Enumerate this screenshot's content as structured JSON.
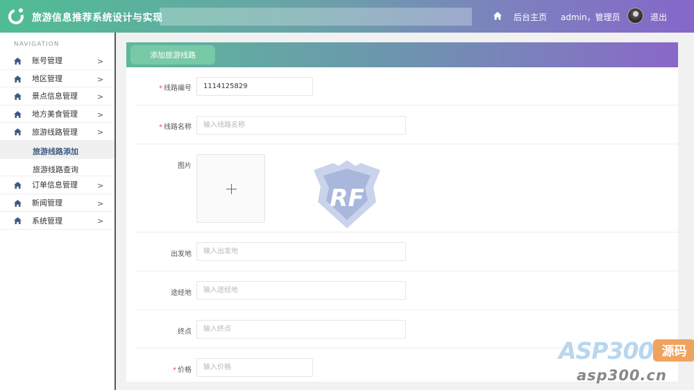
{
  "header": {
    "title": "旅游信息推荐系统设计与实现",
    "home_label": "后台主页",
    "user_text": "admin，管理员",
    "logout_label": "退出"
  },
  "sidebar": {
    "heading": "NAVIGATION",
    "items": [
      {
        "label": "账号管理",
        "icon": "home-icon"
      },
      {
        "label": "地区管理",
        "icon": "home-icon"
      },
      {
        "label": "景点信息管理",
        "icon": "home-icon"
      },
      {
        "label": "地方美食管理",
        "icon": "home-icon"
      },
      {
        "label": "旅游线路管理",
        "icon": "home-icon"
      }
    ],
    "sub_items": [
      {
        "label": "旅游线路添加",
        "active": true
      },
      {
        "label": "旅游线路查询",
        "active": false
      }
    ],
    "items_after": [
      {
        "label": "订单信息管理",
        "icon": "home-icon"
      },
      {
        "label": "新闻管理",
        "icon": "home-icon"
      },
      {
        "label": "系统管理",
        "icon": "home-icon"
      }
    ]
  },
  "main": {
    "card_title": "添加旅游线路",
    "form": {
      "route_no": {
        "label": "线路编号",
        "required": true,
        "value": "1114125829"
      },
      "route_name": {
        "label": "线路名称",
        "required": true,
        "placeholder": "输入线路名称"
      },
      "image": {
        "label": "图片",
        "upload_icon": "plus-icon"
      },
      "departure": {
        "label": "出发地",
        "placeholder": "输入出发地"
      },
      "via": {
        "label": "途经地",
        "placeholder": "输入途经地"
      },
      "destination": {
        "label": "终点",
        "placeholder": "输入终点"
      },
      "price": {
        "label": "价格",
        "required": true,
        "placeholder": "输入价格"
      }
    },
    "emblem_text": "RF"
  },
  "watermark": {
    "brand": "ASP300",
    "badge": "源码",
    "domain": "asp300.cn"
  },
  "colors": {
    "header_gradient_start": "#4fbd93",
    "header_gradient_end": "#8567c9",
    "required_star": "#e05050",
    "active_submenu_text": "#3d5a80",
    "watermark_badge": "#f0a35f"
  }
}
